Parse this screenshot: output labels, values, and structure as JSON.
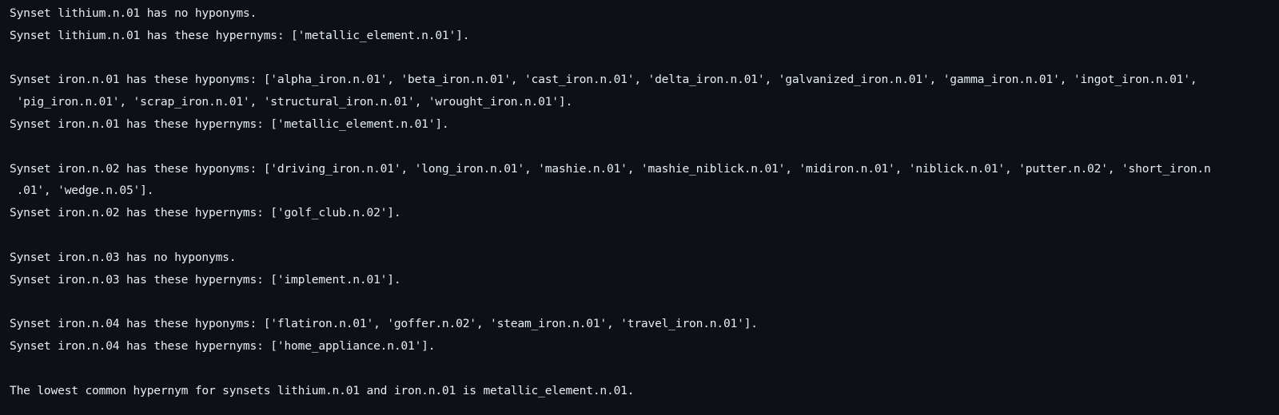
{
  "output": {
    "lines": [
      "Synset lithium.n.01 has no hyponyms.",
      "Synset lithium.n.01 has these hypernyms: ['metallic_element.n.01'].",
      "",
      "Synset iron.n.01 has these hyponyms: ['alpha_iron.n.01', 'beta_iron.n.01', 'cast_iron.n.01', 'delta_iron.n.01', 'galvanized_iron.n.01', 'gamma_iron.n.01', 'ingot_iron.n.01',",
      " 'pig_iron.n.01', 'scrap_iron.n.01', 'structural_iron.n.01', 'wrought_iron.n.01'].",
      "Synset iron.n.01 has these hypernyms: ['metallic_element.n.01'].",
      "",
      "Synset iron.n.02 has these hyponyms: ['driving_iron.n.01', 'long_iron.n.01', 'mashie.n.01', 'mashie_niblick.n.01', 'midiron.n.01', 'niblick.n.01', 'putter.n.02', 'short_iron.n",
      " .01', 'wedge.n.05'].",
      "Synset iron.n.02 has these hypernyms: ['golf_club.n.02'].",
      "",
      "Synset iron.n.03 has no hyponyms.",
      "Synset iron.n.03 has these hypernyms: ['implement.n.01'].",
      "",
      "Synset iron.n.04 has these hyponyms: ['flatiron.n.01', 'goffer.n.02', 'steam_iron.n.01', 'travel_iron.n.01'].",
      "Synset iron.n.04 has these hypernyms: ['home_appliance.n.01'].",
      "",
      "The lowest common hypernym for synsets lithium.n.01 and iron.n.01 is metallic_element.n.01."
    ]
  }
}
